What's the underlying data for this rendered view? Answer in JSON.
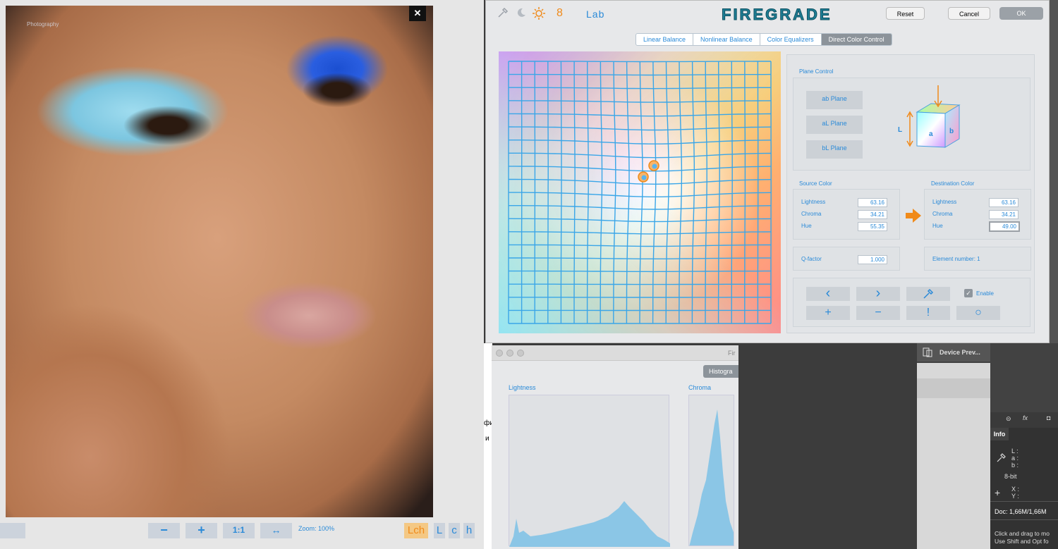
{
  "photo_window": {
    "close_label": "✕",
    "watermark": "Photography",
    "zoom_text": "Zoom: 100%",
    "controls": {
      "minus": "−",
      "plus": "+",
      "one_to_one": "1:1",
      "fit": "↔"
    },
    "view_buttons": [
      "Lch",
      "L",
      "c",
      "h"
    ]
  },
  "firegrade": {
    "logo": "FIREGRADE",
    "bit_depth": "8",
    "color_space": "Lab",
    "buttons": {
      "reset": "Reset",
      "cancel": "Cancel",
      "ok": "OK"
    },
    "tabs": [
      {
        "label": "Linear Balance",
        "active": false
      },
      {
        "label": "Nonlinear Balance",
        "active": false
      },
      {
        "label": "Color Equalizers",
        "active": false
      },
      {
        "label": "Direct Color Control",
        "active": true
      }
    ],
    "plane_control": {
      "title": "Plane Control",
      "planes": [
        "ab Plane",
        "aL Plane",
        "bL Plane"
      ],
      "cube_labels": {
        "L": "L",
        "a": "a",
        "b": "b"
      }
    },
    "source_color": {
      "title": "Source Color",
      "rows": [
        {
          "label": "Lightness",
          "value": "63.16"
        },
        {
          "label": "Chroma",
          "value": "34.21"
        },
        {
          "label": "Hue",
          "value": "55.35"
        }
      ]
    },
    "destination_color": {
      "title": "Destination Color",
      "rows": [
        {
          "label": "Lightness",
          "value": "63.16"
        },
        {
          "label": "Chroma",
          "value": "34.21"
        },
        {
          "label": "Hue",
          "value": "49.00"
        }
      ]
    },
    "q_factor": {
      "label": "Q-factor",
      "value": "1.000"
    },
    "element_number": "Element number: 1",
    "enable_label": "Enable",
    "enable_checked": true,
    "action_glyphs": {
      "prev": "‹",
      "next": "›",
      "add": "+",
      "remove": "−",
      "reset": "!",
      "circle": "○"
    }
  },
  "histogram_window": {
    "title_fragment": "Fir",
    "tab_label": "Histogra",
    "lightness_label": "Lightness",
    "chroma_label": "Chroma"
  },
  "ps_panel": {
    "device_preview": "Device Prev...",
    "info_tab": "Info",
    "lab_labels": [
      "L :",
      "a :",
      "b :"
    ],
    "bit_label": "8-bit",
    "xy_labels": [
      "X :",
      "Y :"
    ],
    "doc_info": "Doc: 1,66M/1,66M",
    "help_line1": "Click and drag to mo",
    "help_line2": "Use Shift and Opt fo"
  },
  "background_text": {
    "line1": "фи",
    "line2": "и"
  }
}
